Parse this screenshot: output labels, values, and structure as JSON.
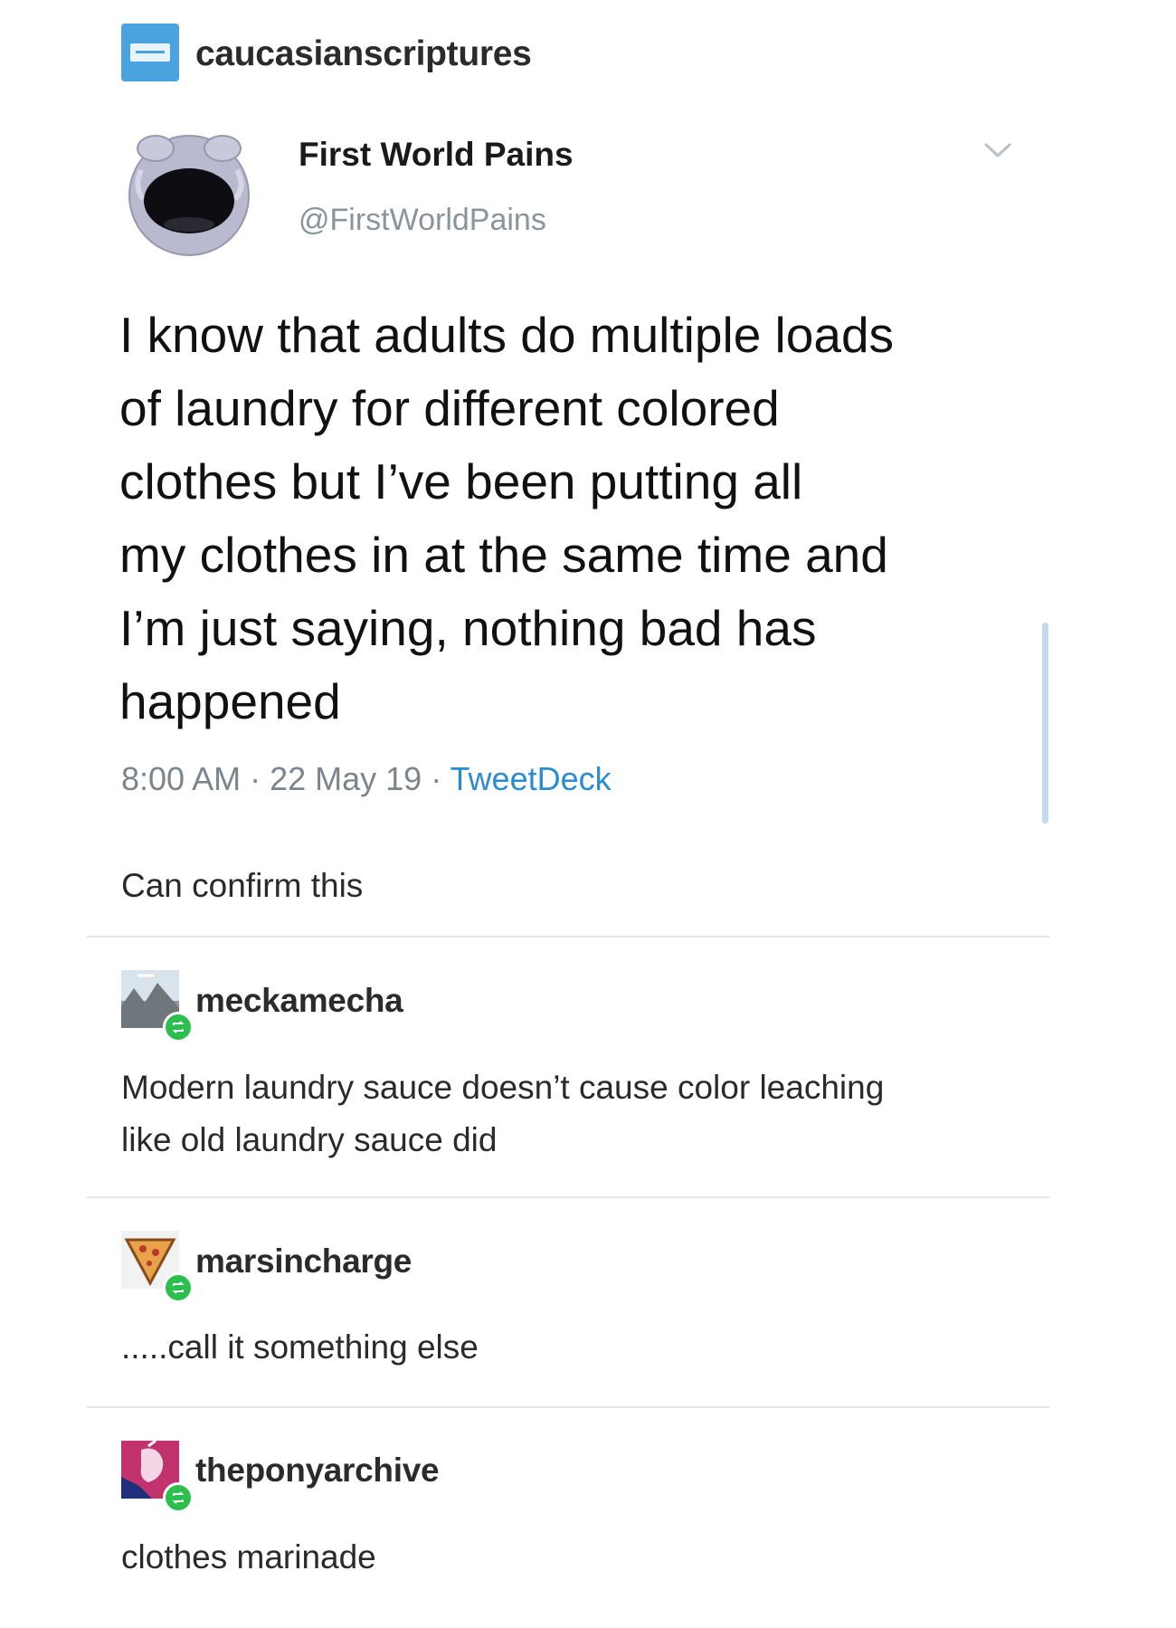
{
  "top_post": {
    "blog_name": "caucasianscriptures",
    "avatar_icon": "blue-card-icon"
  },
  "tweet": {
    "display_name": "First World Pains",
    "handle": "@FirstWorldPains",
    "avatar_icon": "crying-face-icon",
    "menu_icon": "chevron-down-icon",
    "lines": [
      "I know that adults do multiple loads",
      "of laundry for different colored",
      "clothes but I’ve been putting all",
      "my clothes in at the same time and",
      "I’m just saying, nothing bad has",
      "happened"
    ],
    "time": "8:00 AM",
    "date": "22 May 19",
    "separator": " · ",
    "source": "TweetDeck"
  },
  "reblog_comment": "Can confirm this",
  "reblogs": [
    {
      "blog_name": "meckamecha",
      "avatar_icon": "landscape-avatar-icon",
      "lines": [
        "Modern laundry sauce doesn’t cause color leaching",
        "like old laundry sauce did"
      ]
    },
    {
      "blog_name": "marsincharge",
      "avatar_icon": "pizza-slice-avatar-icon",
      "lines": [
        ".....call it something else"
      ]
    },
    {
      "blog_name": "theponyarchive",
      "avatar_icon": "pony-avatar-icon",
      "lines": [
        "clothes marinade"
      ]
    }
  ],
  "colors": {
    "accent_blue": "#2a8bd1",
    "reblog_green": "#2bbf4e",
    "meta_gray": "#7c858c"
  }
}
